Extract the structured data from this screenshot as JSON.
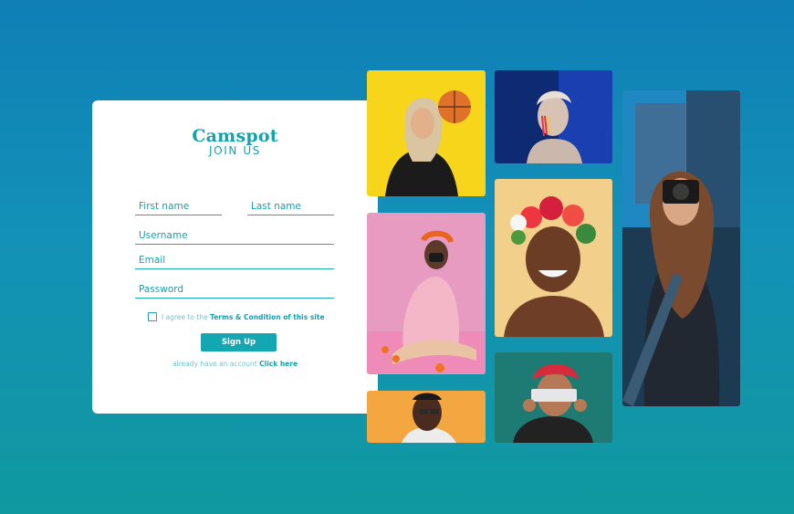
{
  "brand": {
    "logo": "Camspot",
    "subtitle": "JOIN US"
  },
  "form": {
    "first_name_placeholder": "First name",
    "last_name_placeholder": "Last name",
    "username_placeholder": "Username",
    "email_placeholder": "Email",
    "password_placeholder": "Password",
    "agree_prefix": "I agree to the ",
    "agree_link": "Terms & Condition of this site",
    "signup_label": "Sign Up",
    "login_prefix": "already have an account ",
    "login_link": "Click here"
  },
  "colors": {
    "accent": "#13a7b2",
    "background_top": "#0f7fb5",
    "background_bottom": "#10999f"
  },
  "gallery": [
    {
      "name": "photo-woman-basketball",
      "bg": "#f6d51b"
    },
    {
      "name": "photo-man-facepaint",
      "bg": "#0e2a73"
    },
    {
      "name": "photo-woman-photographer",
      "bg": "#2e5f80"
    },
    {
      "name": "photo-woman-mask",
      "bg": "#e79bc0"
    },
    {
      "name": "photo-woman-flower-crown",
      "bg": "#f2cf8a"
    },
    {
      "name": "photo-man-glasses",
      "bg": "#f4a640"
    },
    {
      "name": "photo-woman-red-hat",
      "bg": "#1d7b74"
    }
  ]
}
